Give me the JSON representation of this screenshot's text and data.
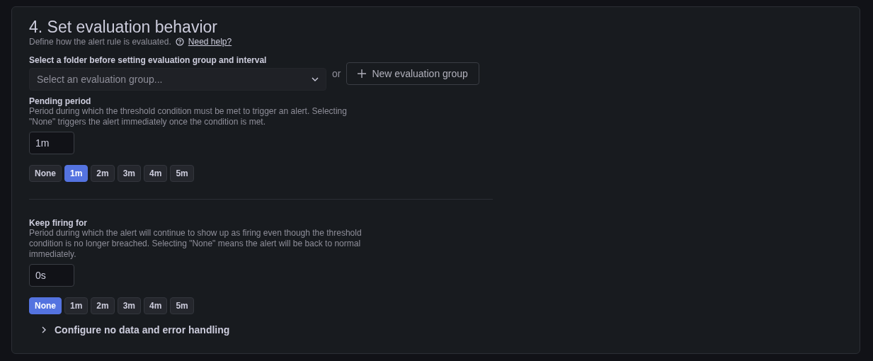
{
  "section": {
    "title": "4. Set evaluation behavior",
    "description": "Define how the alert rule is evaluated.",
    "help_link": "Need help?"
  },
  "evaluation_group": {
    "label": "Select a folder before setting evaluation group and interval",
    "placeholder": "Select an evaluation group...",
    "or": "or",
    "new_button": "New evaluation group"
  },
  "periods": [
    {
      "label": "Pending period",
      "description": "Period during which the threshold condition must be met to trigger an alert. Selecting \"None\" triggers the alert immediately once the condition is met.",
      "value": "1m",
      "options": [
        {
          "label": "None",
          "selected": false
        },
        {
          "label": "1m",
          "selected": true
        },
        {
          "label": "2m",
          "selected": false
        },
        {
          "label": "3m",
          "selected": false
        },
        {
          "label": "4m",
          "selected": false
        },
        {
          "label": "5m",
          "selected": false
        }
      ]
    },
    {
      "label": "Keep firing for",
      "description": "Period during which the alert will continue to show up as firing even though the threshold condition is no longer breached. Selecting \"None\" means the alert will be back to normal immediately.",
      "value": "0s",
      "options": [
        {
          "label": "None",
          "selected": true
        },
        {
          "label": "1m",
          "selected": false
        },
        {
          "label": "2m",
          "selected": false
        },
        {
          "label": "3m",
          "selected": false
        },
        {
          "label": "4m",
          "selected": false
        },
        {
          "label": "5m",
          "selected": false
        }
      ]
    }
  ],
  "collapsible": {
    "label": "Configure no data and error handling",
    "expanded": false
  }
}
